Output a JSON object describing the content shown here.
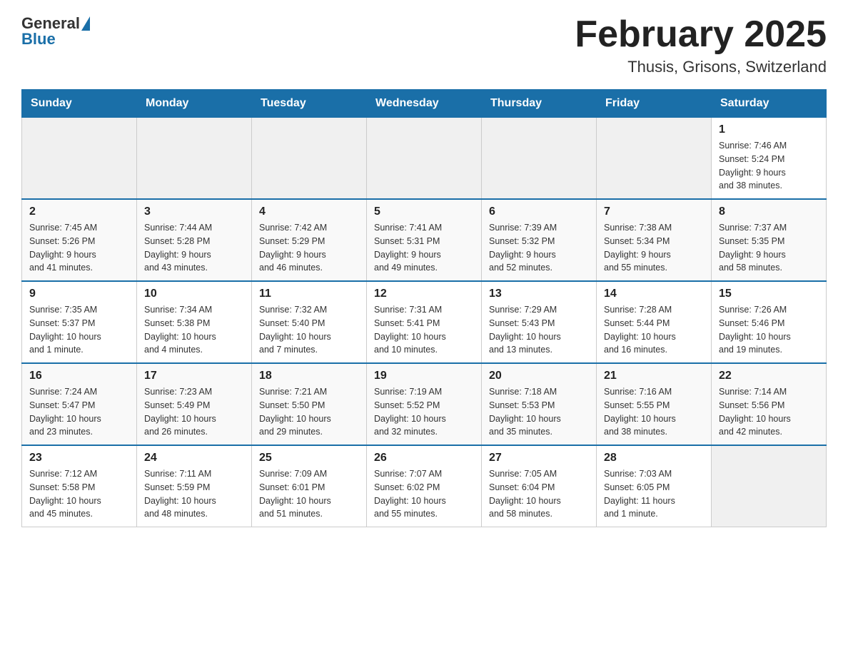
{
  "header": {
    "logo": {
      "text_general": "General",
      "text_blue": "Blue"
    },
    "title": "February 2025",
    "subtitle": "Thusis, Grisons, Switzerland"
  },
  "calendar": {
    "days_of_week": [
      "Sunday",
      "Monday",
      "Tuesday",
      "Wednesday",
      "Thursday",
      "Friday",
      "Saturday"
    ],
    "weeks": [
      [
        {
          "day": "",
          "info": ""
        },
        {
          "day": "",
          "info": ""
        },
        {
          "day": "",
          "info": ""
        },
        {
          "day": "",
          "info": ""
        },
        {
          "day": "",
          "info": ""
        },
        {
          "day": "",
          "info": ""
        },
        {
          "day": "1",
          "info": "Sunrise: 7:46 AM\nSunset: 5:24 PM\nDaylight: 9 hours\nand 38 minutes."
        }
      ],
      [
        {
          "day": "2",
          "info": "Sunrise: 7:45 AM\nSunset: 5:26 PM\nDaylight: 9 hours\nand 41 minutes."
        },
        {
          "day": "3",
          "info": "Sunrise: 7:44 AM\nSunset: 5:28 PM\nDaylight: 9 hours\nand 43 minutes."
        },
        {
          "day": "4",
          "info": "Sunrise: 7:42 AM\nSunset: 5:29 PM\nDaylight: 9 hours\nand 46 minutes."
        },
        {
          "day": "5",
          "info": "Sunrise: 7:41 AM\nSunset: 5:31 PM\nDaylight: 9 hours\nand 49 minutes."
        },
        {
          "day": "6",
          "info": "Sunrise: 7:39 AM\nSunset: 5:32 PM\nDaylight: 9 hours\nand 52 minutes."
        },
        {
          "day": "7",
          "info": "Sunrise: 7:38 AM\nSunset: 5:34 PM\nDaylight: 9 hours\nand 55 minutes."
        },
        {
          "day": "8",
          "info": "Sunrise: 7:37 AM\nSunset: 5:35 PM\nDaylight: 9 hours\nand 58 minutes."
        }
      ],
      [
        {
          "day": "9",
          "info": "Sunrise: 7:35 AM\nSunset: 5:37 PM\nDaylight: 10 hours\nand 1 minute."
        },
        {
          "day": "10",
          "info": "Sunrise: 7:34 AM\nSunset: 5:38 PM\nDaylight: 10 hours\nand 4 minutes."
        },
        {
          "day": "11",
          "info": "Sunrise: 7:32 AM\nSunset: 5:40 PM\nDaylight: 10 hours\nand 7 minutes."
        },
        {
          "day": "12",
          "info": "Sunrise: 7:31 AM\nSunset: 5:41 PM\nDaylight: 10 hours\nand 10 minutes."
        },
        {
          "day": "13",
          "info": "Sunrise: 7:29 AM\nSunset: 5:43 PM\nDaylight: 10 hours\nand 13 minutes."
        },
        {
          "day": "14",
          "info": "Sunrise: 7:28 AM\nSunset: 5:44 PM\nDaylight: 10 hours\nand 16 minutes."
        },
        {
          "day": "15",
          "info": "Sunrise: 7:26 AM\nSunset: 5:46 PM\nDaylight: 10 hours\nand 19 minutes."
        }
      ],
      [
        {
          "day": "16",
          "info": "Sunrise: 7:24 AM\nSunset: 5:47 PM\nDaylight: 10 hours\nand 23 minutes."
        },
        {
          "day": "17",
          "info": "Sunrise: 7:23 AM\nSunset: 5:49 PM\nDaylight: 10 hours\nand 26 minutes."
        },
        {
          "day": "18",
          "info": "Sunrise: 7:21 AM\nSunset: 5:50 PM\nDaylight: 10 hours\nand 29 minutes."
        },
        {
          "day": "19",
          "info": "Sunrise: 7:19 AM\nSunset: 5:52 PM\nDaylight: 10 hours\nand 32 minutes."
        },
        {
          "day": "20",
          "info": "Sunrise: 7:18 AM\nSunset: 5:53 PM\nDaylight: 10 hours\nand 35 minutes."
        },
        {
          "day": "21",
          "info": "Sunrise: 7:16 AM\nSunset: 5:55 PM\nDaylight: 10 hours\nand 38 minutes."
        },
        {
          "day": "22",
          "info": "Sunrise: 7:14 AM\nSunset: 5:56 PM\nDaylight: 10 hours\nand 42 minutes."
        }
      ],
      [
        {
          "day": "23",
          "info": "Sunrise: 7:12 AM\nSunset: 5:58 PM\nDaylight: 10 hours\nand 45 minutes."
        },
        {
          "day": "24",
          "info": "Sunrise: 7:11 AM\nSunset: 5:59 PM\nDaylight: 10 hours\nand 48 minutes."
        },
        {
          "day": "25",
          "info": "Sunrise: 7:09 AM\nSunset: 6:01 PM\nDaylight: 10 hours\nand 51 minutes."
        },
        {
          "day": "26",
          "info": "Sunrise: 7:07 AM\nSunset: 6:02 PM\nDaylight: 10 hours\nand 55 minutes."
        },
        {
          "day": "27",
          "info": "Sunrise: 7:05 AM\nSunset: 6:04 PM\nDaylight: 10 hours\nand 58 minutes."
        },
        {
          "day": "28",
          "info": "Sunrise: 7:03 AM\nSunset: 6:05 PM\nDaylight: 11 hours\nand 1 minute."
        },
        {
          "day": "",
          "info": ""
        }
      ]
    ]
  }
}
